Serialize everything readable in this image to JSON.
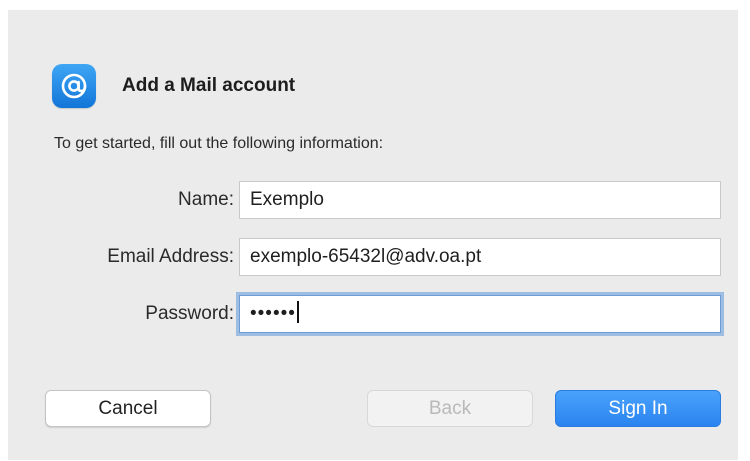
{
  "dialog": {
    "title": "Add a Mail account",
    "intro": "To get started, fill out the following information:",
    "icon": "at-sign-icon",
    "accent": "#2a84f0"
  },
  "form": {
    "name": {
      "label": "Name:",
      "value": "Exemplo"
    },
    "email": {
      "label": "Email Address:",
      "value": "exemplo-65432l@adv.oa.pt"
    },
    "password": {
      "label": "Password:",
      "value": "••••••"
    }
  },
  "buttons": {
    "cancel": "Cancel",
    "back": "Back",
    "sign_in": "Sign In"
  }
}
